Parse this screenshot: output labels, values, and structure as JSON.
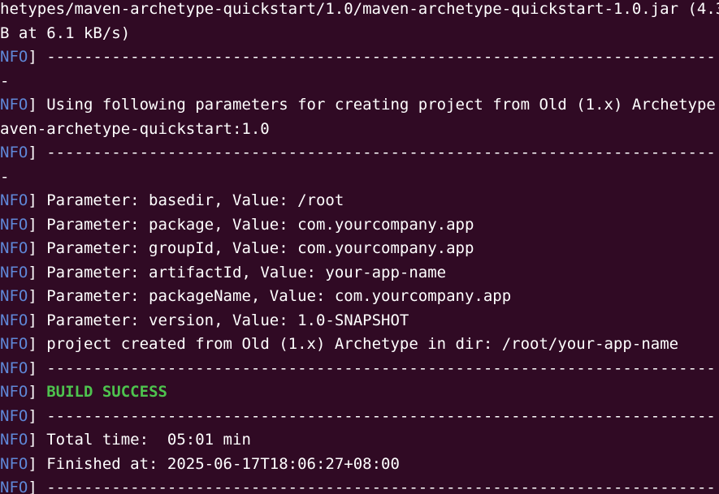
{
  "terminal": {
    "colors": {
      "background": "#300a24",
      "text": "#ffffff",
      "info_tag": "#5f87d7",
      "success": "#4ec34e"
    },
    "lines": [
      {
        "tag": "",
        "text": "hetypes/maven-archetype-quickstart/1.0/maven-archetype-quickstart-1.0.jar (4.3"
      },
      {
        "tag": "",
        "text": "B at 6.1 kB/s)"
      },
      {
        "tag": "NFO",
        "text": " ------------------------------------------------------------------------"
      },
      {
        "tag": "",
        "text": "-"
      },
      {
        "tag": "NFO",
        "text": " Using following parameters for creating project from Old (1.x) Archetype:"
      },
      {
        "tag": "",
        "text": "aven-archetype-quickstart:1.0"
      },
      {
        "tag": "NFO",
        "text": " ------------------------------------------------------------------------"
      },
      {
        "tag": "",
        "text": "-"
      },
      {
        "tag": "NFO",
        "text": " Parameter: basedir, Value: /root"
      },
      {
        "tag": "NFO",
        "text": " Parameter: package, Value: com.yourcompany.app"
      },
      {
        "tag": "NFO",
        "text": " Parameter: groupId, Value: com.yourcompany.app"
      },
      {
        "tag": "NFO",
        "text": " Parameter: artifactId, Value: your-app-name"
      },
      {
        "tag": "NFO",
        "text": " Parameter: packageName, Value: com.yourcompany.app"
      },
      {
        "tag": "NFO",
        "text": " Parameter: version, Value: 1.0-SNAPSHOT"
      },
      {
        "tag": "NFO",
        "text": " project created from Old (1.x) Archetype in dir: /root/your-app-name"
      },
      {
        "tag": "NFO",
        "text": " ------------------------------------------------------------------------"
      },
      {
        "tag": "NFO",
        "text": " ",
        "success": "BUILD SUCCESS"
      },
      {
        "tag": "NFO",
        "text": " ------------------------------------------------------------------------"
      },
      {
        "tag": "NFO",
        "text": " Total time:  05:01 min"
      },
      {
        "tag": "NFO",
        "text": " Finished at: 2025-06-17T18:06:27+08:00"
      },
      {
        "tag": "NFO",
        "text": " ------------------------------------------------------------------------"
      }
    ]
  }
}
